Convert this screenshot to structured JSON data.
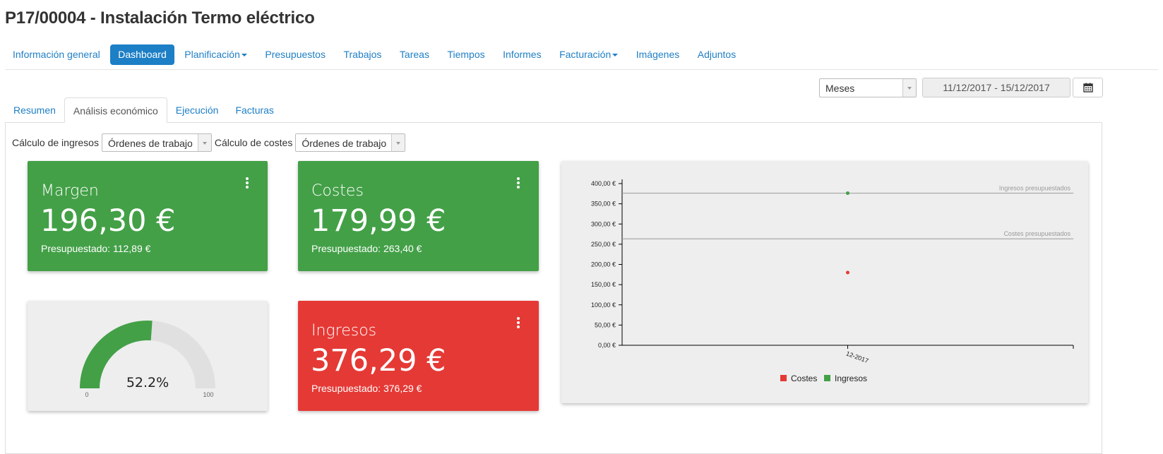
{
  "page": {
    "title": "P17/00004 - Instalación Termo eléctrico"
  },
  "nav": {
    "items": [
      {
        "label": "Información general",
        "active": false,
        "dropdown": false
      },
      {
        "label": "Dashboard",
        "active": true,
        "dropdown": false
      },
      {
        "label": "Planificación",
        "active": false,
        "dropdown": true
      },
      {
        "label": "Presupuestos",
        "active": false,
        "dropdown": false
      },
      {
        "label": "Trabajos",
        "active": false,
        "dropdown": false
      },
      {
        "label": "Tareas",
        "active": false,
        "dropdown": false
      },
      {
        "label": "Tiempos",
        "active": false,
        "dropdown": false
      },
      {
        "label": "Informes",
        "active": false,
        "dropdown": false
      },
      {
        "label": "Facturación",
        "active": false,
        "dropdown": true
      },
      {
        "label": "Imágenes",
        "active": false,
        "dropdown": false
      },
      {
        "label": "Adjuntos",
        "active": false,
        "dropdown": false
      }
    ]
  },
  "filters": {
    "period": "Meses",
    "date_range": "11/12/2017 - 15/12/2017",
    "calendar_icon": "calendar-icon"
  },
  "tabs": [
    {
      "label": "Resumen",
      "active": false
    },
    {
      "label": "Análisis económico",
      "active": true
    },
    {
      "label": "Ejecución",
      "active": false
    },
    {
      "label": "Facturas",
      "active": false
    }
  ],
  "calc": {
    "income_label": "Cálculo de ingresos",
    "income_value": "Órdenes de trabajo",
    "cost_label": "Cálculo de costes",
    "cost_value": "Órdenes de trabajo"
  },
  "cards": {
    "margin": {
      "title": "Margen",
      "value": "196,30 €",
      "sub": "Presupuestado: 112,89 €",
      "color": "#43a047"
    },
    "costs": {
      "title": "Costes",
      "value": "179,99 €",
      "sub": "Presupuestado: 263,40 €",
      "color": "#43a047"
    },
    "income": {
      "title": "Ingresos",
      "value": "376,29 €",
      "sub": "Presupuestado: 376,29 €",
      "color": "#e53935"
    }
  },
  "gauge": {
    "value_text": "52.2%",
    "value": 52.2,
    "min_label": "0",
    "max_label": "100",
    "fill_color": "#43a047",
    "track_color": "#e0e0e0"
  },
  "chart_data": {
    "type": "scatter",
    "x_categories": [
      "12-2017"
    ],
    "y_ticks": [
      "0,00 €",
      "50,00 €",
      "100,00 €",
      "150,00 €",
      "200,00 €",
      "250,00 €",
      "300,00 €",
      "350,00 €",
      "400,00 €"
    ],
    "ylim": [
      0,
      400
    ],
    "series": [
      {
        "name": "Costes",
        "color": "#e53935",
        "points": [
          {
            "x": "12-2017",
            "y": 179.99
          }
        ]
      },
      {
        "name": "Ingresos",
        "color": "#43a047",
        "points": [
          {
            "x": "12-2017",
            "y": 376.29
          }
        ]
      }
    ],
    "reference_lines": [
      {
        "label": "Ingresos presupuestados",
        "y": 376.29
      },
      {
        "label": "Costes presupuestados",
        "y": 263.4
      }
    ],
    "legend_position": "bottom"
  }
}
